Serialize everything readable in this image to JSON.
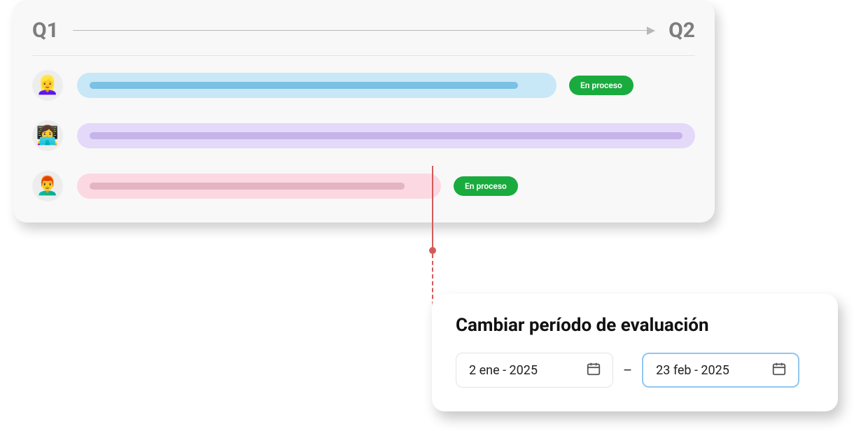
{
  "timeline": {
    "start_label": "Q1",
    "end_label": "Q2",
    "rows": [
      {
        "avatar": "👱‍♀️",
        "status": "En proceso"
      },
      {
        "avatar": "👩‍💻",
        "status": null
      },
      {
        "avatar": "👨‍🦰",
        "status": "En proceso"
      }
    ]
  },
  "modal": {
    "title": "Cambiar período de evaluación",
    "date_from": "2 ene - 2025",
    "date_to": "23 feb - 2025"
  }
}
